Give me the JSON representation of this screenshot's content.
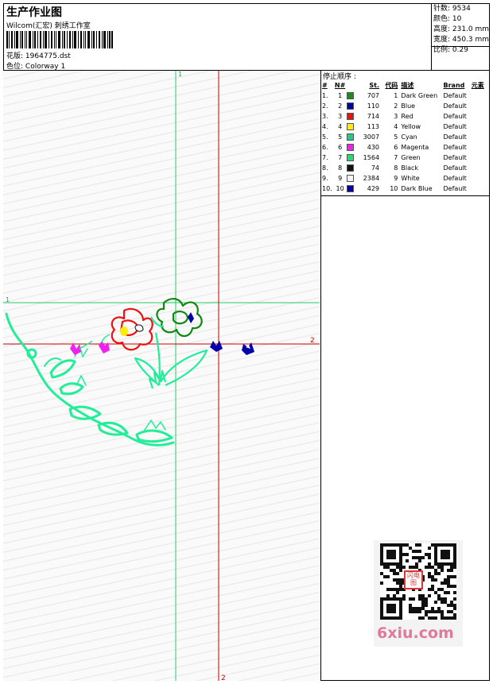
{
  "header": {
    "title": "生产作业图",
    "company": "Wilcom(汇宏) 刺绣工作室",
    "design_label": "花版:",
    "design_value": "1964775.dst",
    "colorway_label": "色位:",
    "colorway_value": "Colorway 1"
  },
  "stats": {
    "stitches": "针数: 9534",
    "colors": "颜色: 10",
    "height": "高度: 231.0 mm",
    "width": "宽度: 450.3 mm",
    "scale": "比例: 0.29"
  },
  "guides": {
    "v1": "1",
    "h1": "1",
    "h2": "2",
    "v2": "2"
  },
  "stop_sequence": {
    "title": "停止顺序 :",
    "headers": {
      "idx": "#",
      "n": "N#",
      "st": "St.",
      "code": "代码",
      "desc": "描述",
      "brand": "Brand",
      "element": "元素"
    },
    "rows": [
      {
        "idx": "1.",
        "n": "1",
        "color": "#1a8f1a",
        "st": "707",
        "code": "1",
        "desc": "Dark Green",
        "brand": "Default"
      },
      {
        "idx": "2.",
        "n": "2",
        "color": "#0000aa",
        "st": "110",
        "code": "2",
        "desc": "Blue",
        "brand": "Default"
      },
      {
        "idx": "3.",
        "n": "3",
        "color": "#ee1111",
        "st": "714",
        "code": "3",
        "desc": "Red",
        "brand": "Default"
      },
      {
        "idx": "4.",
        "n": "4",
        "color": "#ffee00",
        "st": "113",
        "code": "4",
        "desc": "Yellow",
        "brand": "Default"
      },
      {
        "idx": "5.",
        "n": "5",
        "color": "#22cc88",
        "st": "3007",
        "code": "5",
        "desc": "Cyan",
        "brand": "Default"
      },
      {
        "idx": "6.",
        "n": "6",
        "color": "#ee22ee",
        "st": "430",
        "code": "6",
        "desc": "Magenta",
        "brand": "Default"
      },
      {
        "idx": "7.",
        "n": "7",
        "color": "#22dd77",
        "st": "1564",
        "code": "7",
        "desc": "Green",
        "brand": "Default"
      },
      {
        "idx": "8.",
        "n": "8",
        "color": "#111111",
        "st": "74",
        "code": "8",
        "desc": "Black",
        "brand": "Default"
      },
      {
        "idx": "9.",
        "n": "9",
        "color": "#f4f4f4",
        "st": "2384",
        "code": "9",
        "desc": "White",
        "brand": "Default"
      },
      {
        "idx": "10.",
        "n": "10",
        "color": "#0000aa",
        "st": "429",
        "code": "10",
        "desc": "Dark Blue",
        "brand": "Default"
      }
    ]
  },
  "watermark": {
    "seal": "闪电图",
    "site": "6xiu.com"
  },
  "colors": {
    "guide_green": "#22cc66",
    "guide_red": "#cc0000",
    "leaf": "#22ee99",
    "dark_green": "#118811",
    "red": "#ee1111",
    "blue": "#0000aa",
    "magenta": "#ee22ee"
  }
}
